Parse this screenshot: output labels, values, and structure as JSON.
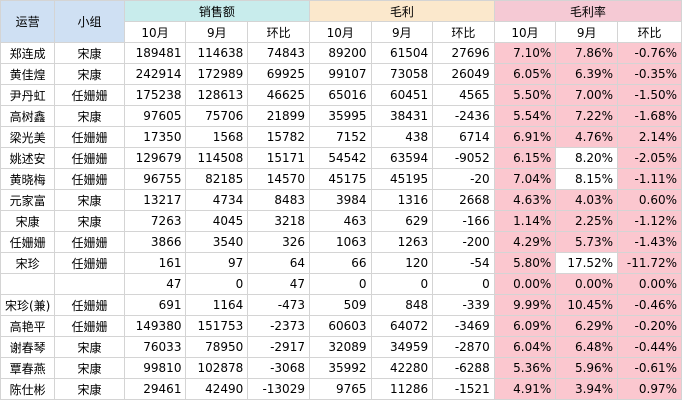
{
  "header": {
    "col1": "运营",
    "col2": "小组",
    "groups": [
      "销售额",
      "毛利",
      "毛利率"
    ],
    "sub": [
      "10月",
      "9月",
      "环比",
      "10月",
      "9月",
      "环比",
      "10月",
      "9月",
      "环比"
    ]
  },
  "rows": [
    [
      "郑连成",
      "宋康",
      "189481",
      "114638",
      "74843",
      "89200",
      "61504",
      "27696",
      "7.10%",
      "7.86%",
      "-0.76%"
    ],
    [
      "黄佳煌",
      "宋康",
      "242914",
      "172989",
      "69925",
      "99107",
      "73058",
      "26049",
      "6.05%",
      "6.39%",
      "-0.35%"
    ],
    [
      "尹丹虹",
      "任姗姗",
      "175238",
      "128613",
      "46625",
      "65016",
      "60451",
      "4565",
      "5.50%",
      "7.00%",
      "-1.50%"
    ],
    [
      "高树鑫",
      "宋康",
      "97605",
      "75706",
      "21899",
      "35995",
      "38431",
      "-2436",
      "5.54%",
      "7.22%",
      "-1.68%"
    ],
    [
      "梁光美",
      "任姗姗",
      "17350",
      "1568",
      "15782",
      "7152",
      "438",
      "6714",
      "6.91%",
      "4.76%",
      "2.14%"
    ],
    [
      "姚述安",
      "任姗姗",
      "129679",
      "114508",
      "15171",
      "54542",
      "63594",
      "-9052",
      "6.15%",
      "8.20%",
      "-2.05%"
    ],
    [
      "黄晓梅",
      "任姗姗",
      "96755",
      "82185",
      "14570",
      "45175",
      "45195",
      "-20",
      "7.04%",
      "8.15%",
      "-1.11%"
    ],
    [
      "元家富",
      "宋康",
      "13217",
      "4734",
      "8483",
      "3984",
      "1316",
      "2668",
      "4.63%",
      "4.03%",
      "0.60%"
    ],
    [
      "宋康",
      "宋康",
      "7263",
      "4045",
      "3218",
      "463",
      "629",
      "-166",
      "1.14%",
      "2.25%",
      "-1.12%"
    ],
    [
      "任姗姗",
      "任姗姗",
      "3866",
      "3540",
      "326",
      "1063",
      "1263",
      "-200",
      "4.29%",
      "5.73%",
      "-1.43%"
    ],
    [
      "宋珍",
      "任姗姗",
      "161",
      "97",
      "64",
      "66",
      "120",
      "-54",
      "5.80%",
      "17.52%",
      "-11.72%"
    ],
    [
      "",
      "",
      "47",
      "0",
      "47",
      "0",
      "0",
      "0",
      "0.00%",
      "0.00%",
      "0.00%"
    ],
    [
      "宋珍(兼)",
      "任姗姗",
      "691",
      "1164",
      "-473",
      "509",
      "848",
      "-339",
      "9.99%",
      "10.45%",
      "-0.46%"
    ],
    [
      "高艳平",
      "任姗姗",
      "149380",
      "151753",
      "-2373",
      "60603",
      "64072",
      "-3469",
      "6.09%",
      "6.29%",
      "-0.20%"
    ],
    [
      "谢春琴",
      "宋康",
      "76033",
      "78950",
      "-2917",
      "32089",
      "34959",
      "-2870",
      "6.04%",
      "6.48%",
      "-0.44%"
    ],
    [
      "覃春燕",
      "宋康",
      "99810",
      "102878",
      "-3068",
      "35992",
      "42280",
      "-6288",
      "5.36%",
      "5.96%",
      "-0.61%"
    ],
    [
      "陈仕彬",
      "宋康",
      "29461",
      "42490",
      "-13029",
      "9765",
      "11286",
      "-1521",
      "4.91%",
      "3.94%",
      "0.97%"
    ]
  ],
  "colors": {
    "header_blue": "#cfe0f3",
    "header_green": "#c8ecec",
    "header_orange": "#fbe8cc",
    "header_pink": "#f5c9d4",
    "highlight_pink": "#fbc7cf",
    "grid": "#d4d4d4"
  },
  "white_cells": [
    [
      5,
      9
    ],
    [
      6,
      9
    ],
    [
      10,
      9
    ]
  ]
}
